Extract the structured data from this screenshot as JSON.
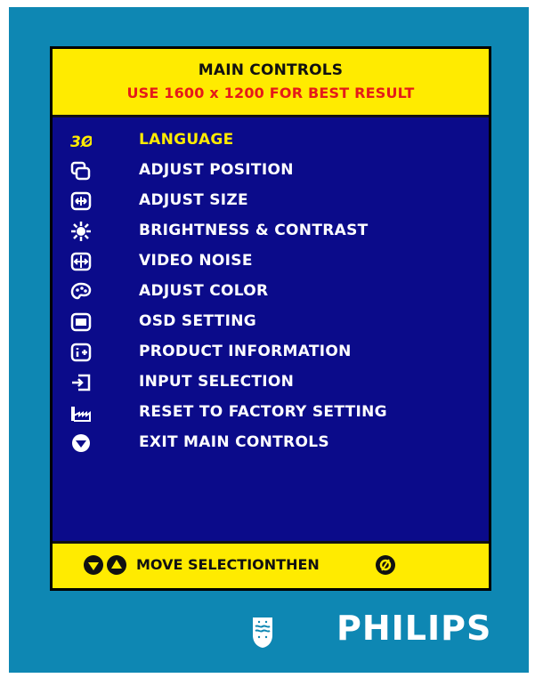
{
  "osd": {
    "title": "MAIN CONTROLS",
    "subtitle": "USE 1600 x 1200 FOR BEST RESULT",
    "items": [
      {
        "label": "LANGUAGE",
        "icon": "language-icon",
        "selected": true
      },
      {
        "label": "ADJUST POSITION",
        "icon": "position-icon",
        "selected": false
      },
      {
        "label": "ADJUST SIZE",
        "icon": "size-icon",
        "selected": false
      },
      {
        "label": "BRIGHTNESS & CONTRAST",
        "icon": "brightness-icon",
        "selected": false
      },
      {
        "label": "VIDEO NOISE",
        "icon": "video-noise-icon",
        "selected": false
      },
      {
        "label": "ADJUST COLOR",
        "icon": "color-palette-icon",
        "selected": false
      },
      {
        "label": "OSD SETTING",
        "icon": "osd-icon",
        "selected": false
      },
      {
        "label": "PRODUCT INFORMATION",
        "icon": "info-icon",
        "selected": false
      },
      {
        "label": "INPUT SELECTION",
        "icon": "input-icon",
        "selected": false
      },
      {
        "label": "RESET TO FACTORY SETTING",
        "icon": "factory-reset-icon",
        "selected": false
      },
      {
        "label": "EXIT MAIN CONTROLS",
        "icon": "exit-icon",
        "selected": false
      }
    ],
    "footer": {
      "text": "MOVE SELECTIONTHEN",
      "icons": [
        "down-arrow-icon",
        "up-arrow-icon",
        "ok-icon"
      ]
    }
  },
  "brand": {
    "name": "PHILIPS"
  },
  "colors": {
    "frame": "#0e87b3",
    "panel": "#0b0b8a",
    "header": "#ffeb00",
    "selected": "#ffeb00",
    "subtitle": "#e41a1a"
  }
}
